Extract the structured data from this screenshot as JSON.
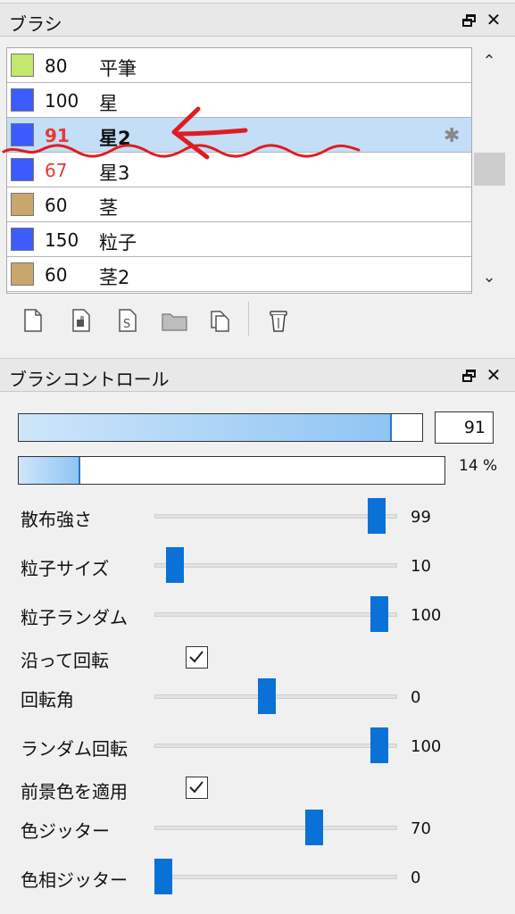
{
  "brush_panel": {
    "title": "ブラシ",
    "brushes": [
      {
        "size": "80",
        "name": "平筆",
        "color": "#c2e86e",
        "size_color": "#111111"
      },
      {
        "size": "100",
        "name": "星",
        "color": "#3c5cff",
        "size_color": "#111111"
      },
      {
        "size": "91",
        "name": "星2",
        "color": "#3c5cff",
        "size_color": "#e53935",
        "selected": true
      },
      {
        "size": "67",
        "name": "星3",
        "color": "#3c5cff",
        "size_color": "#e53935"
      },
      {
        "size": "60",
        "name": "茎",
        "color": "#c8a66e",
        "size_color": "#111111"
      },
      {
        "size": "150",
        "name": "粒子",
        "color": "#3c5cff",
        "size_color": "#111111"
      },
      {
        "size": "60",
        "name": "茎2",
        "color": "#c8a66e",
        "size_color": "#111111"
      }
    ]
  },
  "control_panel": {
    "title": "ブラシコントロール",
    "size_value": "91",
    "size_fill": 0.92,
    "opacity_label": "14 %",
    "opacity_fill": 0.14,
    "sliders": [
      {
        "label": "散布強さ",
        "value": "99",
        "level": 0.95
      },
      {
        "label": "粒子サイズ",
        "value": "10",
        "level": 0.05
      },
      {
        "label": "粒子ランダム",
        "value": "100",
        "level": 0.96
      },
      {
        "label": "回転角",
        "value": "0",
        "level": 0.46
      },
      {
        "label": "ランダム回転",
        "value": "100",
        "level": 0.96
      },
      {
        "label": "色ジッター",
        "value": "70",
        "level": 0.67
      },
      {
        "label": "色相ジッター",
        "value": "0",
        "level": 0.0
      }
    ],
    "checkboxes": [
      {
        "label": "沿って回転",
        "checked": true
      },
      {
        "label": "前景色を適用",
        "checked": true
      }
    ]
  },
  "annotation_color": "#e01b22",
  "accent_color": "#0a72d6"
}
